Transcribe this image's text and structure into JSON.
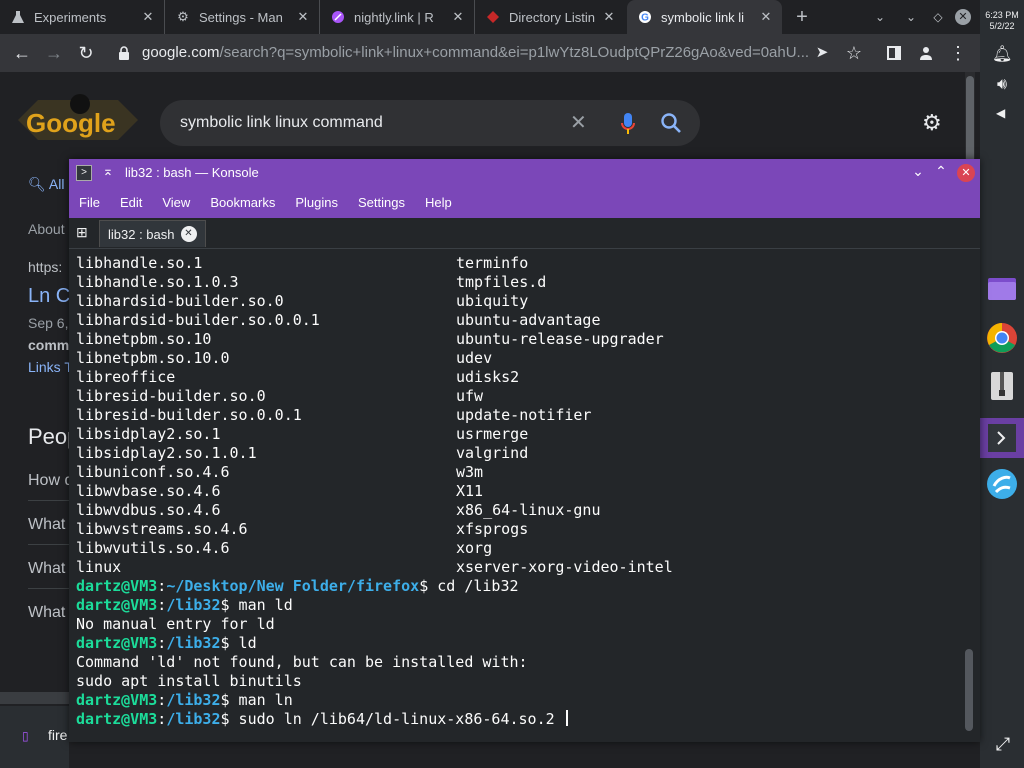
{
  "browser": {
    "tabs": [
      {
        "label": "Experiments",
        "icon": "flask-icon"
      },
      {
        "label": "Settings - Man",
        "icon": "gear-icon"
      },
      {
        "label": "nightly.link | R",
        "icon": "link-icon"
      },
      {
        "label": "Directory Listin",
        "icon": "bug-icon"
      },
      {
        "label": "symbolic link li",
        "icon": "google-icon"
      }
    ],
    "new_tab_label": "+",
    "url_host": "google.com",
    "url_path": "/search?q=symbolic+link+linux+command&ei=p1lwYtz8LOudptQPrZ26gAo&ved=0ahU..."
  },
  "google": {
    "logo_text": "Google",
    "search_query": "symbolic link linux command",
    "tab_all": "All",
    "about": "About",
    "https": "https:",
    "result_title": "Ln C",
    "result_date": "Sep 6,",
    "result_bold": "comm",
    "result_links": "Links T",
    "people_heading": "Peop",
    "questions": [
      "How d",
      "What",
      "What",
      "What"
    ]
  },
  "panel": {
    "clock_time": "6:23 PM",
    "clock_date": "5/2/22"
  },
  "konsole": {
    "title": "lib32 : bash — Konsole",
    "menu": [
      "File",
      "Edit",
      "View",
      "Bookmarks",
      "Plugins",
      "Settings",
      "Help"
    ],
    "tab_label": "lib32 : bash",
    "listing": [
      [
        "libhandle.so.1",
        "terminfo"
      ],
      [
        "libhandle.so.1.0.3",
        "tmpfiles.d"
      ],
      [
        "libhardsid-builder.so.0",
        "ubiquity"
      ],
      [
        "libhardsid-builder.so.0.0.1",
        "ubuntu-advantage"
      ],
      [
        "libnetpbm.so.10",
        "ubuntu-release-upgrader"
      ],
      [
        "libnetpbm.so.10.0",
        "udev"
      ],
      [
        "libreoffice",
        "udisks2"
      ],
      [
        "libresid-builder.so.0",
        "ufw"
      ],
      [
        "libresid-builder.so.0.0.1",
        "update-notifier"
      ],
      [
        "libsidplay2.so.1",
        "usrmerge"
      ],
      [
        "libsidplay2.so.1.0.1",
        "valgrind"
      ],
      [
        "libuniconf.so.4.6",
        "w3m"
      ],
      [
        "libwvbase.so.4.6",
        "X11"
      ],
      [
        "libwvdbus.so.4.6",
        "x86_64-linux-gnu"
      ],
      [
        "libwvstreams.so.4.6",
        "xfsprogs"
      ],
      [
        "libwvutils.so.4.6",
        "xorg"
      ],
      [
        "linux",
        "xserver-xorg-video-intel"
      ]
    ],
    "prompt_user": "dartz@VM3",
    "session": [
      {
        "type": "prompt",
        "path": "~/Desktop/New Folder/firefox",
        "cmd": " cd /lib32"
      },
      {
        "type": "prompt",
        "path": "/lib32",
        "cmd": " man ld"
      },
      {
        "type": "out",
        "text": "No manual entry for ld"
      },
      {
        "type": "prompt",
        "path": "/lib32",
        "cmd": " ld"
      },
      {
        "type": "out",
        "text": "Command 'ld' not found, but can be installed with:"
      },
      {
        "type": "out",
        "text": "sudo apt install binutils"
      },
      {
        "type": "prompt",
        "path": "/lib32",
        "cmd": " man ln"
      },
      {
        "type": "prompt",
        "path": "/lib32",
        "cmd": " sudo ln /lib64/ld-linux-x86-64.so.2 "
      }
    ]
  },
  "taskbar": {
    "task_label": "fire"
  }
}
